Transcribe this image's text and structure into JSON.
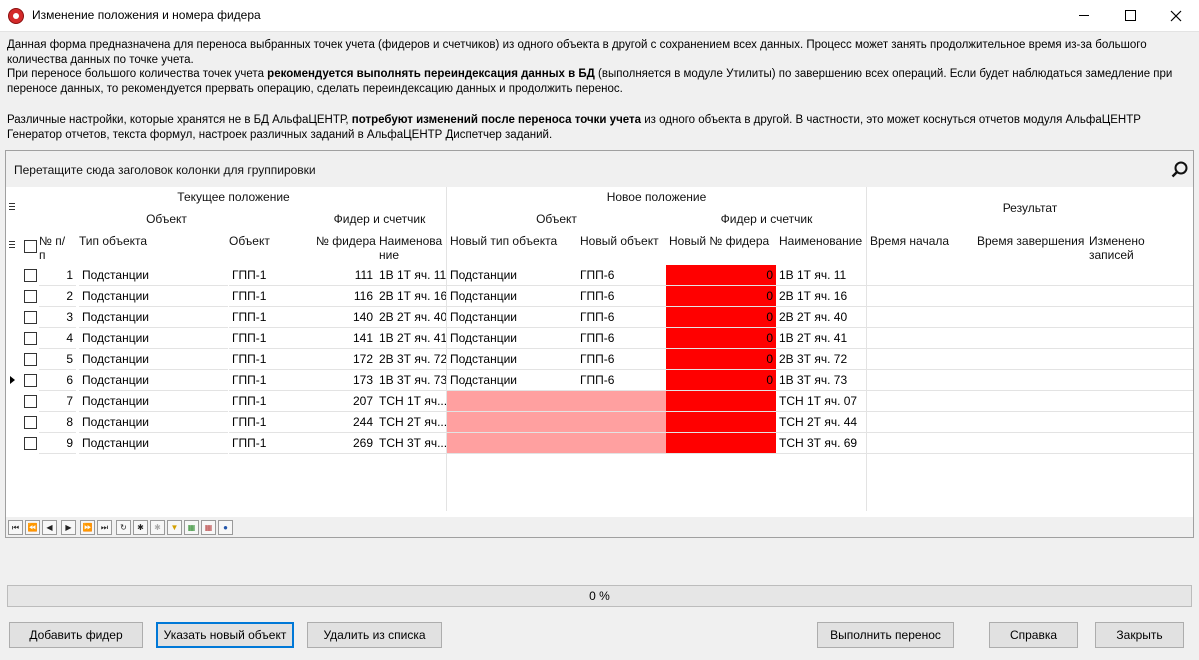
{
  "window": {
    "title": "Изменение положения и номера фидера"
  },
  "description": {
    "p1_a": "Данная форма предназначена для переноса выбранных точек учета (фидеров и счетчиков) из одного объекта в другой с сохранением всех данных. Процесс может занять продолжительное время из-за большого количества данных по точке учета.",
    "p1_b": "При переносе большого количества точек учета ",
    "p1_b_bold": "рекомендуется выполнять переиндексация данных в БД",
    "p1_c": " (выполняется в модуле Утилиты) по завершению всех операций. Если будет наблюдаться замедление при переносе данных, то рекомендуется прервать операцию, сделать переиндексацию данных и продолжить перенос.",
    "p2_a": "Различные настройки, которые хранятся не в БД АльфаЦЕНТР, ",
    "p2_bold": "потребуют изменений после переноса точки учета",
    "p2_b": " из одного объекта в другой. В частности, это может коснуться отчетов модуля АльфаЦЕНТР Генератор отчетов, текста формул, настроек различных заданий в АльфаЦЕНТР Диспетчер заданий."
  },
  "grid": {
    "group_hint": "Перетащите сюда заголовок колонки для группировки",
    "bands": {
      "current": "Текущее положение",
      "current_object": "Объект",
      "current_feeder": "Фидер и счетчик",
      "new": "Новое положение",
      "new_object": "Объект",
      "new_feeder": "Фидер и счетчик",
      "result": "Результат"
    },
    "columns": {
      "num": "№ п/п",
      "obj_type": "Тип объекта",
      "object": "Объект",
      "feeder_no": "№ фидера",
      "name": "Наименование",
      "new_obj_type": "Новый тип объекта",
      "new_object": "Новый объект",
      "new_feeder_no": "Новый № фидера",
      "new_name": "Наименование",
      "start_time": "Время начала",
      "end_time": "Время завершения",
      "changed": "Изменено записей"
    },
    "rows": [
      {
        "n": "1",
        "type": "Подстанции",
        "obj": "ГПП-1",
        "fno": "111",
        "name": "1В 1Т яч. 11",
        "ntype": "Подстанции",
        "nobj": "ГПП-6",
        "nfno": "0",
        "nname": "1В 1Т яч. 11"
      },
      {
        "n": "2",
        "type": "Подстанции",
        "obj": "ГПП-1",
        "fno": "116",
        "name": "2В 1Т яч. 16",
        "ntype": "Подстанции",
        "nobj": "ГПП-6",
        "nfno": "0",
        "nname": "2В 1Т яч. 16"
      },
      {
        "n": "3",
        "type": "Подстанции",
        "obj": "ГПП-1",
        "fno": "140",
        "name": "2В 2Т яч. 40",
        "ntype": "Подстанции",
        "nobj": "ГПП-6",
        "nfno": "0",
        "nname": "2В 2Т яч. 40"
      },
      {
        "n": "4",
        "type": "Подстанции",
        "obj": "ГПП-1",
        "fno": "141",
        "name": "1В 2Т яч. 41",
        "ntype": "Подстанции",
        "nobj": "ГПП-6",
        "nfno": "0",
        "nname": "1В 2Т яч. 41"
      },
      {
        "n": "5",
        "type": "Подстанции",
        "obj": "ГПП-1",
        "fno": "172",
        "name": "2В 3Т яч. 72",
        "ntype": "Подстанции",
        "nobj": "ГПП-6",
        "nfno": "0",
        "nname": "2В 3Т яч. 72"
      },
      {
        "n": "6",
        "type": "Подстанции",
        "obj": "ГПП-1",
        "fno": "173",
        "name": "1В 3Т яч. 73",
        "ntype": "Подстанции",
        "nobj": "ГПП-6",
        "nfno": "0",
        "nname": "1В 3Т яч. 73"
      },
      {
        "n": "7",
        "type": "Подстанции",
        "obj": "ГПП-1",
        "fno": "207",
        "name": "ТСН 1Т яч....",
        "ntype": "",
        "nobj": "",
        "nfno": "",
        "nname": "ТСН 1Т яч. 07"
      },
      {
        "n": "8",
        "type": "Подстанции",
        "obj": "ГПП-1",
        "fno": "244",
        "name": "ТСН 2Т яч....",
        "ntype": "",
        "nobj": "",
        "nfno": "",
        "nname": "ТСН 2Т яч. 44"
      },
      {
        "n": "9",
        "type": "Подстанции",
        "obj": "ГПП-1",
        "fno": "269",
        "name": "ТСН 3Т яч....",
        "ntype": "",
        "nobj": "",
        "nfno": "",
        "nname": "ТСН 3Т яч. 69"
      }
    ],
    "selected_row": 6
  },
  "progress": {
    "value": 0,
    "label": "0 %"
  },
  "buttons": {
    "add_feeder": "Добавить фидер",
    "set_new_object": "Указать новый объект",
    "remove": "Удалить из списка",
    "execute": "Выполнить перенос",
    "help": "Справка",
    "close": "Закрыть"
  },
  "colors": {
    "error": "#ff0000",
    "missing": "#ffa0a0",
    "focus": "#0078d7"
  }
}
